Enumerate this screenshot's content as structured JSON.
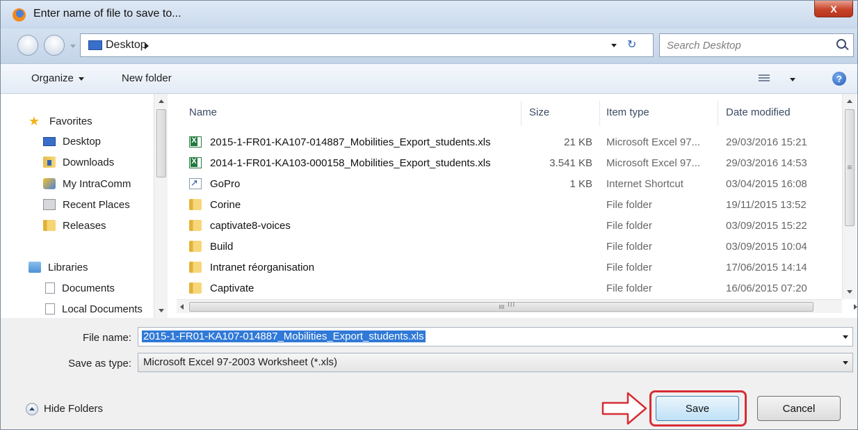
{
  "window": {
    "title": "Enter name of file to save to...",
    "close_glyph": "X"
  },
  "address": {
    "location": "Desktop",
    "refresh_glyph": "↻",
    "search_placeholder": "Search Desktop"
  },
  "toolbar": {
    "organize_label": "Organize",
    "new_folder_label": "New folder",
    "help_glyph": "?"
  },
  "nav": {
    "favorites_label": "Favorites",
    "favorites": [
      {
        "label": "Desktop",
        "icon": "desktop-icon"
      },
      {
        "label": "Downloads",
        "icon": "downloads-icon"
      },
      {
        "label": "My IntraComm",
        "icon": "intracomm-icon"
      },
      {
        "label": "Recent Places",
        "icon": "recent-places-icon"
      },
      {
        "label": "Releases",
        "icon": "folder-icon"
      }
    ],
    "libraries_label": "Libraries",
    "libraries": [
      {
        "label": "Documents",
        "icon": "document-icon"
      },
      {
        "label": "Local Documents",
        "icon": "document-icon"
      }
    ]
  },
  "files": {
    "columns": [
      "Name",
      "Size",
      "Item type",
      "Date modified"
    ],
    "rows": [
      {
        "name": "2015-1-FR01-KA107-014887_Mobilities_Export_students.xls",
        "size": "21 KB",
        "type": "Microsoft Excel 97...",
        "date": "29/03/2016 15:21",
        "icon": "excel-file-icon"
      },
      {
        "name": "2014-1-FR01-KA103-000158_Mobilities_Export_students.xls",
        "size": "3.541 KB",
        "type": "Microsoft Excel 97...",
        "date": "29/03/2016 14:53",
        "icon": "excel-file-icon"
      },
      {
        "name": "GoPro",
        "size": "1 KB",
        "type": "Internet Shortcut",
        "date": "03/04/2015 16:08",
        "icon": "shortcut-icon"
      },
      {
        "name": "Corine",
        "size": "",
        "type": "File folder",
        "date": "19/11/2015 13:52",
        "icon": "folder-icon"
      },
      {
        "name": "captivate8-voices",
        "size": "",
        "type": "File folder",
        "date": "03/09/2015 15:22",
        "icon": "folder-icon"
      },
      {
        "name": "Build",
        "size": "",
        "type": "File folder",
        "date": "03/09/2015 10:04",
        "icon": "folder-icon"
      },
      {
        "name": "Intranet réorganisation",
        "size": "",
        "type": "File folder",
        "date": "17/06/2015 14:14",
        "icon": "folder-icon"
      },
      {
        "name": "Captivate",
        "size": "",
        "type": "File folder",
        "date": "16/06/2015 07:20",
        "icon": "folder-icon"
      }
    ],
    "scroll_grip": "III"
  },
  "form": {
    "file_name_label": "File name:",
    "file_name_value": "2015-1-FR01-KA107-014887_Mobilities_Export_students.xls",
    "save_type_label": "Save as type:",
    "save_type_value": "Microsoft Excel 97-2003 Worksheet (*.xls)"
  },
  "footer": {
    "hide_folders_label": "Hide Folders",
    "save_label": "Save",
    "cancel_label": "Cancel"
  },
  "colors": {
    "highlight": "#d62d35",
    "selection": "#3079d6"
  }
}
